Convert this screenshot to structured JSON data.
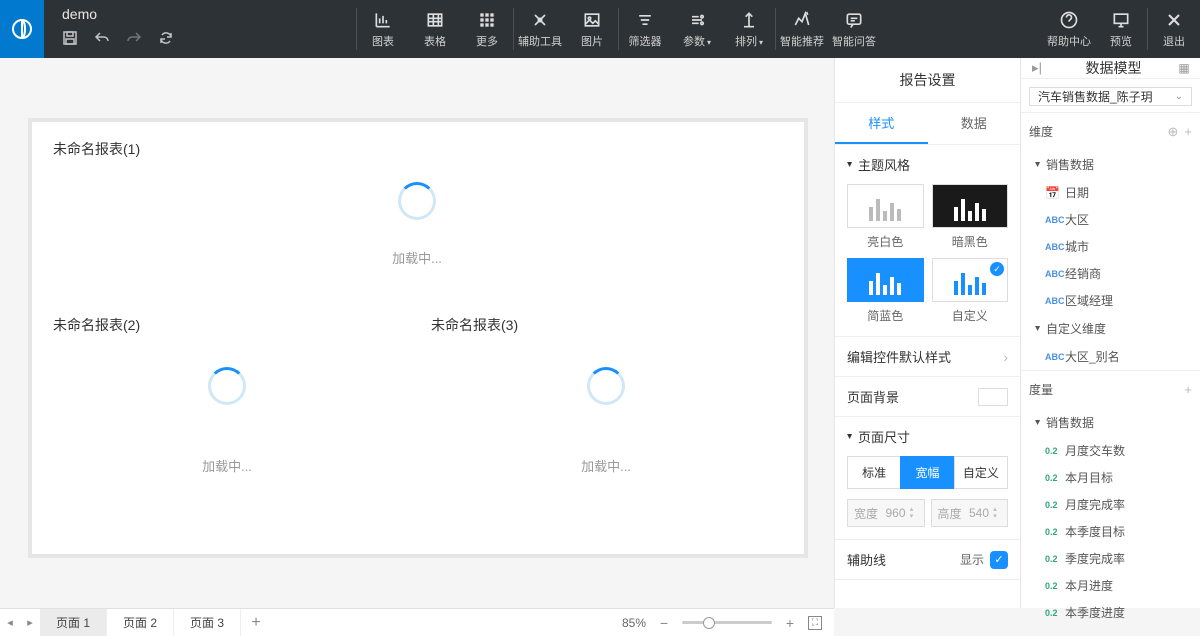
{
  "app": {
    "title": "demo"
  },
  "toolbar": {
    "chart": "图表",
    "table": "表格",
    "more": "更多",
    "auxtool": "辅助工具",
    "image": "图片",
    "filter": "筛选器",
    "param": "参数",
    "sort": "排列",
    "smart_recommend": "智能推荐",
    "smart_qa": "智能问答",
    "help": "帮助中心",
    "preview": "预览",
    "exit": "退出"
  },
  "cards": [
    {
      "title": "未命名报表(1)",
      "loading": "加载中..."
    },
    {
      "title": "未命名报表(2)",
      "loading": "加载中..."
    },
    {
      "title": "未命名报表(3)",
      "loading": "加载中..."
    }
  ],
  "settings": {
    "title": "报告设置",
    "tab_style": "样式",
    "tab_data": "数据",
    "theme_section": "主题风格",
    "themes": {
      "light": "亮白色",
      "dark": "暗黑色",
      "blue": "简蓝色",
      "custom": "自定义"
    },
    "control_style": "编辑控件默认样式",
    "page_bg": "页面背景",
    "page_size": "页面尺寸",
    "size_opts": {
      "standard": "标准",
      "wide": "宽幅",
      "custom": "自定义"
    },
    "width_label": "宽度",
    "width_value": "960",
    "height_label": "高度",
    "height_value": "540",
    "aux_line": "辅助线",
    "aux_show": "显示"
  },
  "model": {
    "title": "数据模型",
    "datasource": "汽车销售数据_陈子玥",
    "dim_label": "维度",
    "meas_label": "度量",
    "group_sales": "销售数据",
    "group_custom_dim": "自定义维度",
    "dims": [
      {
        "type": "date",
        "name": "日期"
      },
      {
        "type": "abc",
        "name": "大区"
      },
      {
        "type": "abc",
        "name": "城市"
      },
      {
        "type": "abc",
        "name": "经销商"
      },
      {
        "type": "abc",
        "name": "区域经理"
      }
    ],
    "custom_dims": [
      {
        "type": "abc",
        "name": "大区_别名"
      }
    ],
    "measures": [
      {
        "name": "月度交车数"
      },
      {
        "name": "本月目标"
      },
      {
        "name": "月度完成率"
      },
      {
        "name": "本季度目标"
      },
      {
        "name": "季度完成率"
      },
      {
        "name": "本月进度"
      },
      {
        "name": "本季度进度"
      }
    ]
  },
  "footer": {
    "pages": [
      "页面 1",
      "页面 2",
      "页面 3"
    ],
    "zoom": "85%"
  }
}
